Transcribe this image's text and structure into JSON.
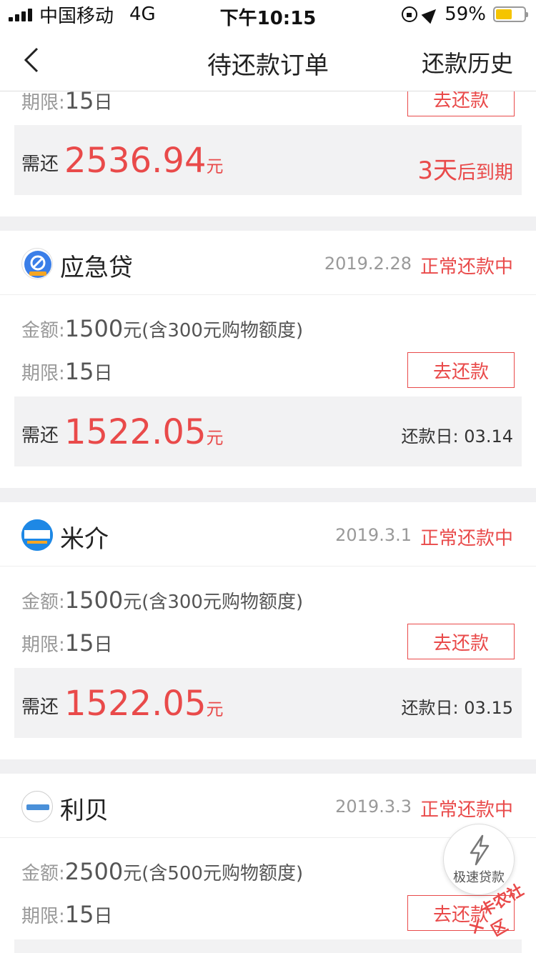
{
  "status_bar": {
    "carrier": "中国移动",
    "network": "4G",
    "time": "下午10:15",
    "battery_percent": "59%",
    "battery_level": 0.59,
    "battery_color": "#f5c400"
  },
  "nav": {
    "title": "待还款订单",
    "history": "还款历史",
    "back_icon": "chevron-left-icon"
  },
  "accent_color": "#e94a4a",
  "partial_card": {
    "term_label": "期限:",
    "term_value": "15",
    "term_unit": "日",
    "pay_button": "去还款",
    "due_label": "需还",
    "due_amount": "2536.94",
    "due_unit": "元",
    "due_days": "3天",
    "due_days_suffix": "后到期"
  },
  "orders": [
    {
      "name": "应急贷",
      "date": "2019.2.28",
      "status": "正常还款中",
      "amount_label": "金额:",
      "amount_value": "1500",
      "amount_desc": "元(含300元购物额度)",
      "term_label": "期限:",
      "term_value": "15",
      "term_unit": "日",
      "pay_button": "去还款",
      "due_label": "需还",
      "due_amount": "1522.05",
      "due_unit": "元",
      "due_date_label": "还款日:",
      "due_date": "03.14"
    },
    {
      "name": "米介",
      "date": "2019.3.1",
      "status": "正常还款中",
      "amount_label": "金额:",
      "amount_value": "1500",
      "amount_desc": "元(含300元购物额度)",
      "term_label": "期限:",
      "term_value": "15",
      "term_unit": "日",
      "pay_button": "去还款",
      "due_label": "需还",
      "due_amount": "1522.05",
      "due_unit": "元",
      "due_date_label": "还款日:",
      "due_date": "03.15"
    },
    {
      "name": "利贝",
      "date": "2019.3.3",
      "status": "正常还款中",
      "amount_label": "金额:",
      "amount_value": "2500",
      "amount_desc": "元(含500元购物额度)",
      "term_label": "期限:",
      "term_value": "15",
      "term_unit": "日",
      "pay_button": "去还款"
    }
  ],
  "float_button": {
    "label": "极速贷款",
    "icon": "lightning-icon"
  },
  "watermark": "卡农社区"
}
